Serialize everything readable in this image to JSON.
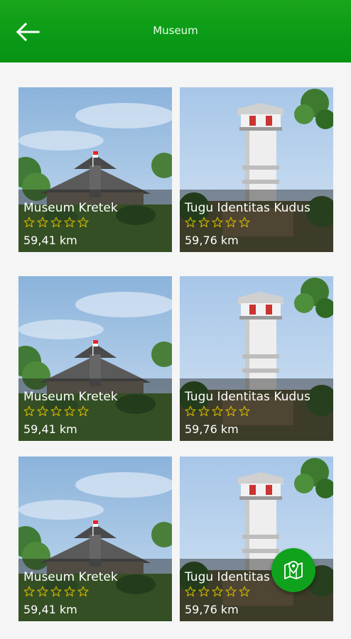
{
  "header": {
    "title": "Museum"
  },
  "cards": [
    {
      "name": "Museum Kretek",
      "distance": "59,41 km",
      "rating": 0,
      "kind": "museum"
    },
    {
      "name": "Tugu Identitas Kudus",
      "distance": "59,76 km",
      "rating": 0,
      "kind": "tower"
    },
    {
      "name": "Museum Kretek",
      "distance": "59,41 km",
      "rating": 0,
      "kind": "museum"
    },
    {
      "name": "Tugu Identitas Kudus",
      "distance": "59,76 km",
      "rating": 0,
      "kind": "tower"
    },
    {
      "name": "Museum Kretek",
      "distance": "59,41 km",
      "rating": 0,
      "kind": "museum"
    },
    {
      "name": "Tugu Identitas Kudus",
      "distance": "59,76 km",
      "rating": 0,
      "kind": "tower"
    }
  ],
  "icons": {
    "back": "arrow-left-icon",
    "star": "star-outline-icon",
    "fab": "map-marker-icon"
  },
  "colors": {
    "appbar": "#0a9a17",
    "fab": "#10a21c",
    "star_outline": "#c8b000"
  }
}
